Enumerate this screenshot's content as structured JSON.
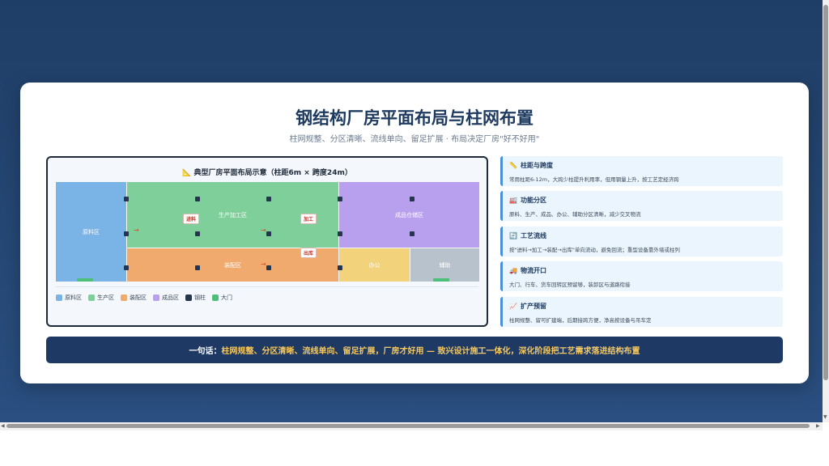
{
  "header": {
    "title": "钢结构厂房平面布局与柱网布置",
    "subtitle": "柱网规整、分区清晰、流线单向、留足扩展 · 布局决定厂房\"好不好用\""
  },
  "diagram": {
    "title": "📐 典型厂房平面布局示意（柱距6m × 跨度24m）",
    "zones": {
      "raw": "原料区",
      "production": "生产加工区",
      "assembly": "装配区",
      "finished": "成品仓储区",
      "office": "办公",
      "auxiliary": "辅助"
    },
    "tags": {
      "feed": "进料",
      "process": "加工",
      "outbound": "出库"
    },
    "legend": [
      "原料区",
      "生产区",
      "装配区",
      "成品区",
      "钢柱",
      "大门"
    ],
    "colors": {
      "raw": "#7ab3e6",
      "production": "#7ecf9a",
      "assembly": "#f0aa6e",
      "finished": "#b9a0ee",
      "office": "#f2d27a",
      "auxiliary": "#b7c2cc",
      "column": "#24354d",
      "gate": "#4cbf7a"
    }
  },
  "info": [
    {
      "icon": "ruler-icon",
      "title": "柱距与跨度",
      "desc": "常用柱距6-12m，大跨少柱提升利用率，但用钢量上升，按工艺定经济跨"
    },
    {
      "icon": "factory-icon",
      "title": "功能分区",
      "desc": "原料、生产、成品、办公、辅助分区清晰，减少交叉物流"
    },
    {
      "icon": "cycle-icon",
      "title": "工艺流线",
      "desc": "按\"进料→加工→装配→出库\"单向流动，避免回流；重型设备靠外墙或柱列"
    },
    {
      "icon": "truck-icon",
      "title": "物流开口",
      "desc": "大门、行车、货车回转区预留够，装卸区与道路衔接"
    },
    {
      "icon": "chart-up-icon",
      "title": "扩产预留",
      "desc": "柱网规整、留可扩建端，后期接跨方便，净高按设备与吊车定"
    }
  ],
  "banner": {
    "lead": "一句话：",
    "text": "柱网规整、分区清晰、流线单向、留足扩展，厂房才好用 — 致兴设计施工一体化，深化阶段把工艺需求落进结构布置"
  }
}
